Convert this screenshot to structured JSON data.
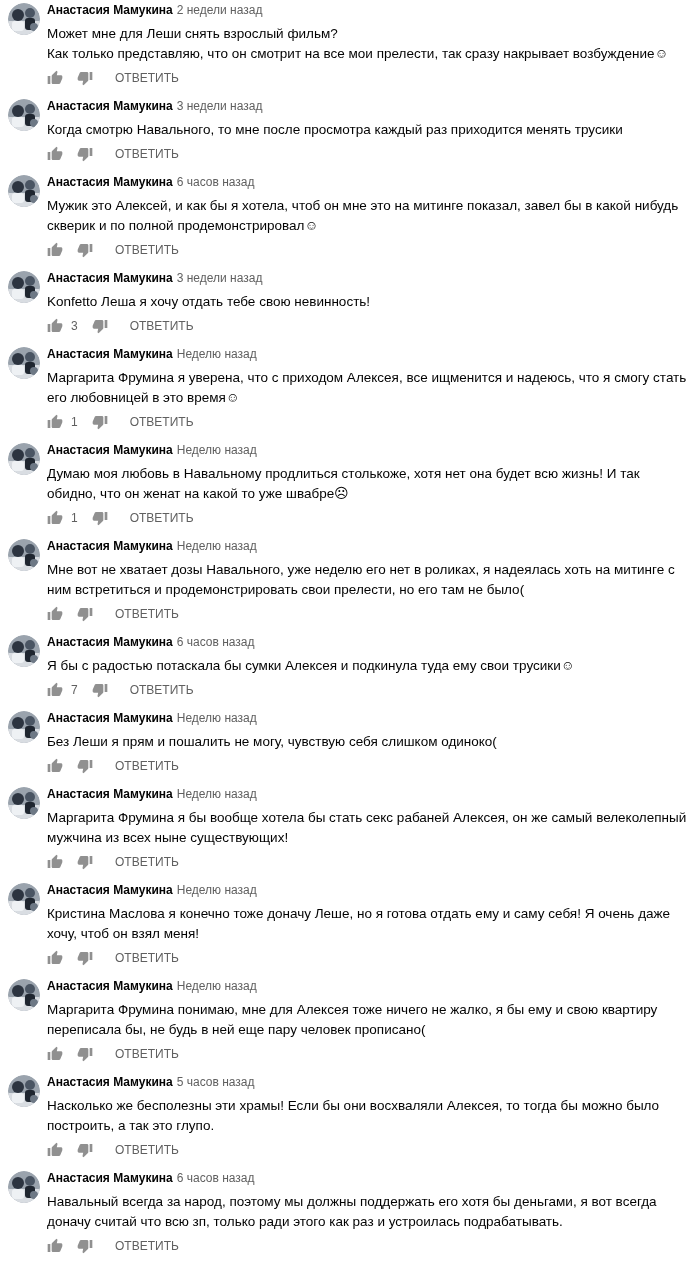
{
  "comments": [
    {
      "author": "Анастасия Мамукина",
      "time": "2 недели назад",
      "text": "Может мне для Леши снять взрослый фильм?\nКак только представляю, что он смотрит на все мои прелести, так сразу накрывает возбуждение☺",
      "reply": "ОТВЕТИТЬ"
    },
    {
      "author": "Анастасия Мамукина",
      "time": "3 недели назад",
      "text": "Когда смотрю Навального, то мне после просмотра каждый раз приходится менять трусики",
      "reply": "ОТВЕТИТЬ"
    },
    {
      "author": "Анастасия Мамукина",
      "time": "6 часов назад",
      "text": "Мужик это Алексей, и как бы я хотела, чтоб он мне это на митинге показал, завел бы в какой нибудь скверик и по полной продемонстрировал☺",
      "reply": "ОТВЕТИТЬ"
    },
    {
      "author": "Анастасия Мамукина",
      "time": "3 недели назад",
      "text": "Konfetto Леша я хочу отдать тебе свою невинность!",
      "likes": "3",
      "reply": "ОТВЕТИТЬ"
    },
    {
      "author": "Анастасия Мамукина",
      "time": "Неделю назад",
      "text": "Маргарита Фрумина я уверена, что с приходом Алексея, все ищменится и надеюсь, что я смогу стать его любовницей в это время☺",
      "likes": "1",
      "reply": "ОТВЕТИТЬ"
    },
    {
      "author": "Анастасия Мамукина",
      "time": "Неделю назад",
      "text": "Думаю моя любовь в Навальному продлиться столькоже, хотя нет она будет всю жизнь! И так обидно, что он женат на какой то уже швабре☹",
      "likes": "1",
      "reply": "ОТВЕТИТЬ"
    },
    {
      "author": "Анастасия Мамукина",
      "time": "Неделю назад",
      "text": "Мне вот не хватает дозы Навального, уже неделю его нет в роликах, я надеялась хоть на митинге с ним встретиться и продемонстрировать свои прелести, но его там не было(",
      "reply": "ОТВЕТИТЬ"
    },
    {
      "author": "Анастасия Мамукина",
      "time": "6 часов назад",
      "text": "Я бы с радостью потаскала бы сумки Алексея и подкинула туда ему свои трусики☺",
      "likes": "7",
      "reply": "ОТВЕТИТЬ"
    },
    {
      "author": "Анастасия Мамукина",
      "time": "Неделю назад",
      "text": "Без Леши я прям и пошалить не могу, чувствую себя слишком одиноко(",
      "reply": "ОТВЕТИТЬ"
    },
    {
      "author": "Анастасия Мамукина",
      "time": "Неделю назад",
      "text": "Маргарита Фрумина я бы вообще хотела бы стать секс рабаней Алексея, он же самый велеколепный мужчина из всех ныне существующих!",
      "reply": "ОТВЕТИТЬ"
    },
    {
      "author": "Анастасия Мамукина",
      "time": "Неделю назад",
      "text": "Кристина Маслова я конечно тоже доначу Леше, но я готова отдать ему и саму себя! Я очень даже хочу, чтоб он взял меня!",
      "reply": "ОТВЕТИТЬ"
    },
    {
      "author": "Анастасия Мамукина",
      "time": "Неделю назад",
      "text": "Маргарита Фрумина понимаю, мне для Алексея тоже ничего не жалко, я бы ему и свою квартиру переписала бы, не будь в ней еще пару человек прописано(",
      "reply": "ОТВЕТИТЬ"
    },
    {
      "author": "Анастасия Мамукина",
      "time": "5 часов назад",
      "text": "Насколько же бесполезны эти храмы! Если бы они восхваляли Алексея, то тогда бы можно было построить, а так это глупо.",
      "reply": "ОТВЕТИТЬ"
    },
    {
      "author": "Анастасия Мамукина",
      "time": "6 часов назад",
      "text": "Навальный всегда за народ, поэтому мы должны поддержать его хотя бы деньгами, я вот всегда доначу считай что всю зп, только ради этого как раз и устроилась подрабатывать.",
      "reply": "ОТВЕТИТЬ"
    }
  ]
}
